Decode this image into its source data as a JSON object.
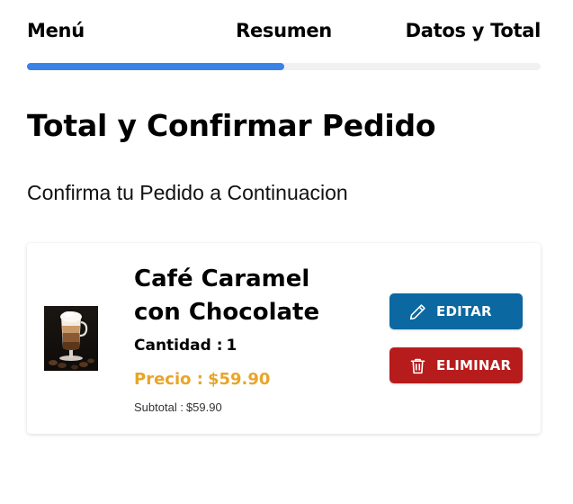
{
  "stepper": {
    "steps": [
      {
        "label": "Menú"
      },
      {
        "label": "Resumen"
      },
      {
        "label": "Datos y Total"
      }
    ],
    "progress_fraction": 0.5,
    "active_color": "#3b82e6",
    "track_color": "#f1f1f1"
  },
  "page": {
    "title": "Total y Confirmar Pedido",
    "subtitle": "Confirma tu Pedido a Continuacion"
  },
  "order_item": {
    "image_icon": "coffee-glass-image",
    "name": "Café Caramel con Chocolate",
    "quantity_label": "Cantidad :",
    "quantity": "1",
    "price_label": "Precio :",
    "price": "$59.90",
    "subtotal_label": "Subtotal :",
    "subtotal": "$59.90",
    "price_color": "#e9a528",
    "actions": {
      "edit_label": "EDITAR",
      "edit_icon": "pencil-icon",
      "edit_color": "#0b68a0",
      "delete_label": "ELIMINAR",
      "delete_icon": "trash-icon",
      "delete_color": "#b71c1c"
    }
  }
}
